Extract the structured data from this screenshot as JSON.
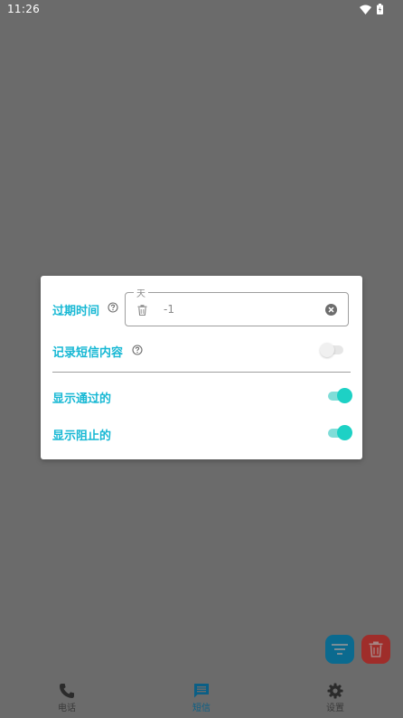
{
  "status_bar": {
    "time": "11:26"
  },
  "dialog": {
    "expiry": {
      "label": "过期时间",
      "field_legend": "天",
      "field_value": "-1"
    },
    "record_sms": {
      "label": "记录短信内容",
      "enabled": false
    },
    "show_passed": {
      "label": "显示通过的",
      "enabled": true
    },
    "show_blocked": {
      "label": "显示阻止的",
      "enabled": true
    }
  },
  "fabs": {
    "filter": "filter-icon",
    "delete": "trash-icon"
  },
  "bottom_nav": {
    "items": [
      {
        "label": "电话",
        "icon": "phone-icon"
      },
      {
        "label": "短信",
        "icon": "message-icon",
        "selected": true
      },
      {
        "label": "设置",
        "icon": "gear-icon"
      }
    ]
  },
  "colors": {
    "accent": "#17b8d4",
    "switch_on": "#1dd1c5",
    "scrim": "#6b6b6b",
    "nav_selected": "#0a5f86",
    "filter_fab": "#0b6a8f",
    "delete_fab": "#9f2d2a"
  }
}
